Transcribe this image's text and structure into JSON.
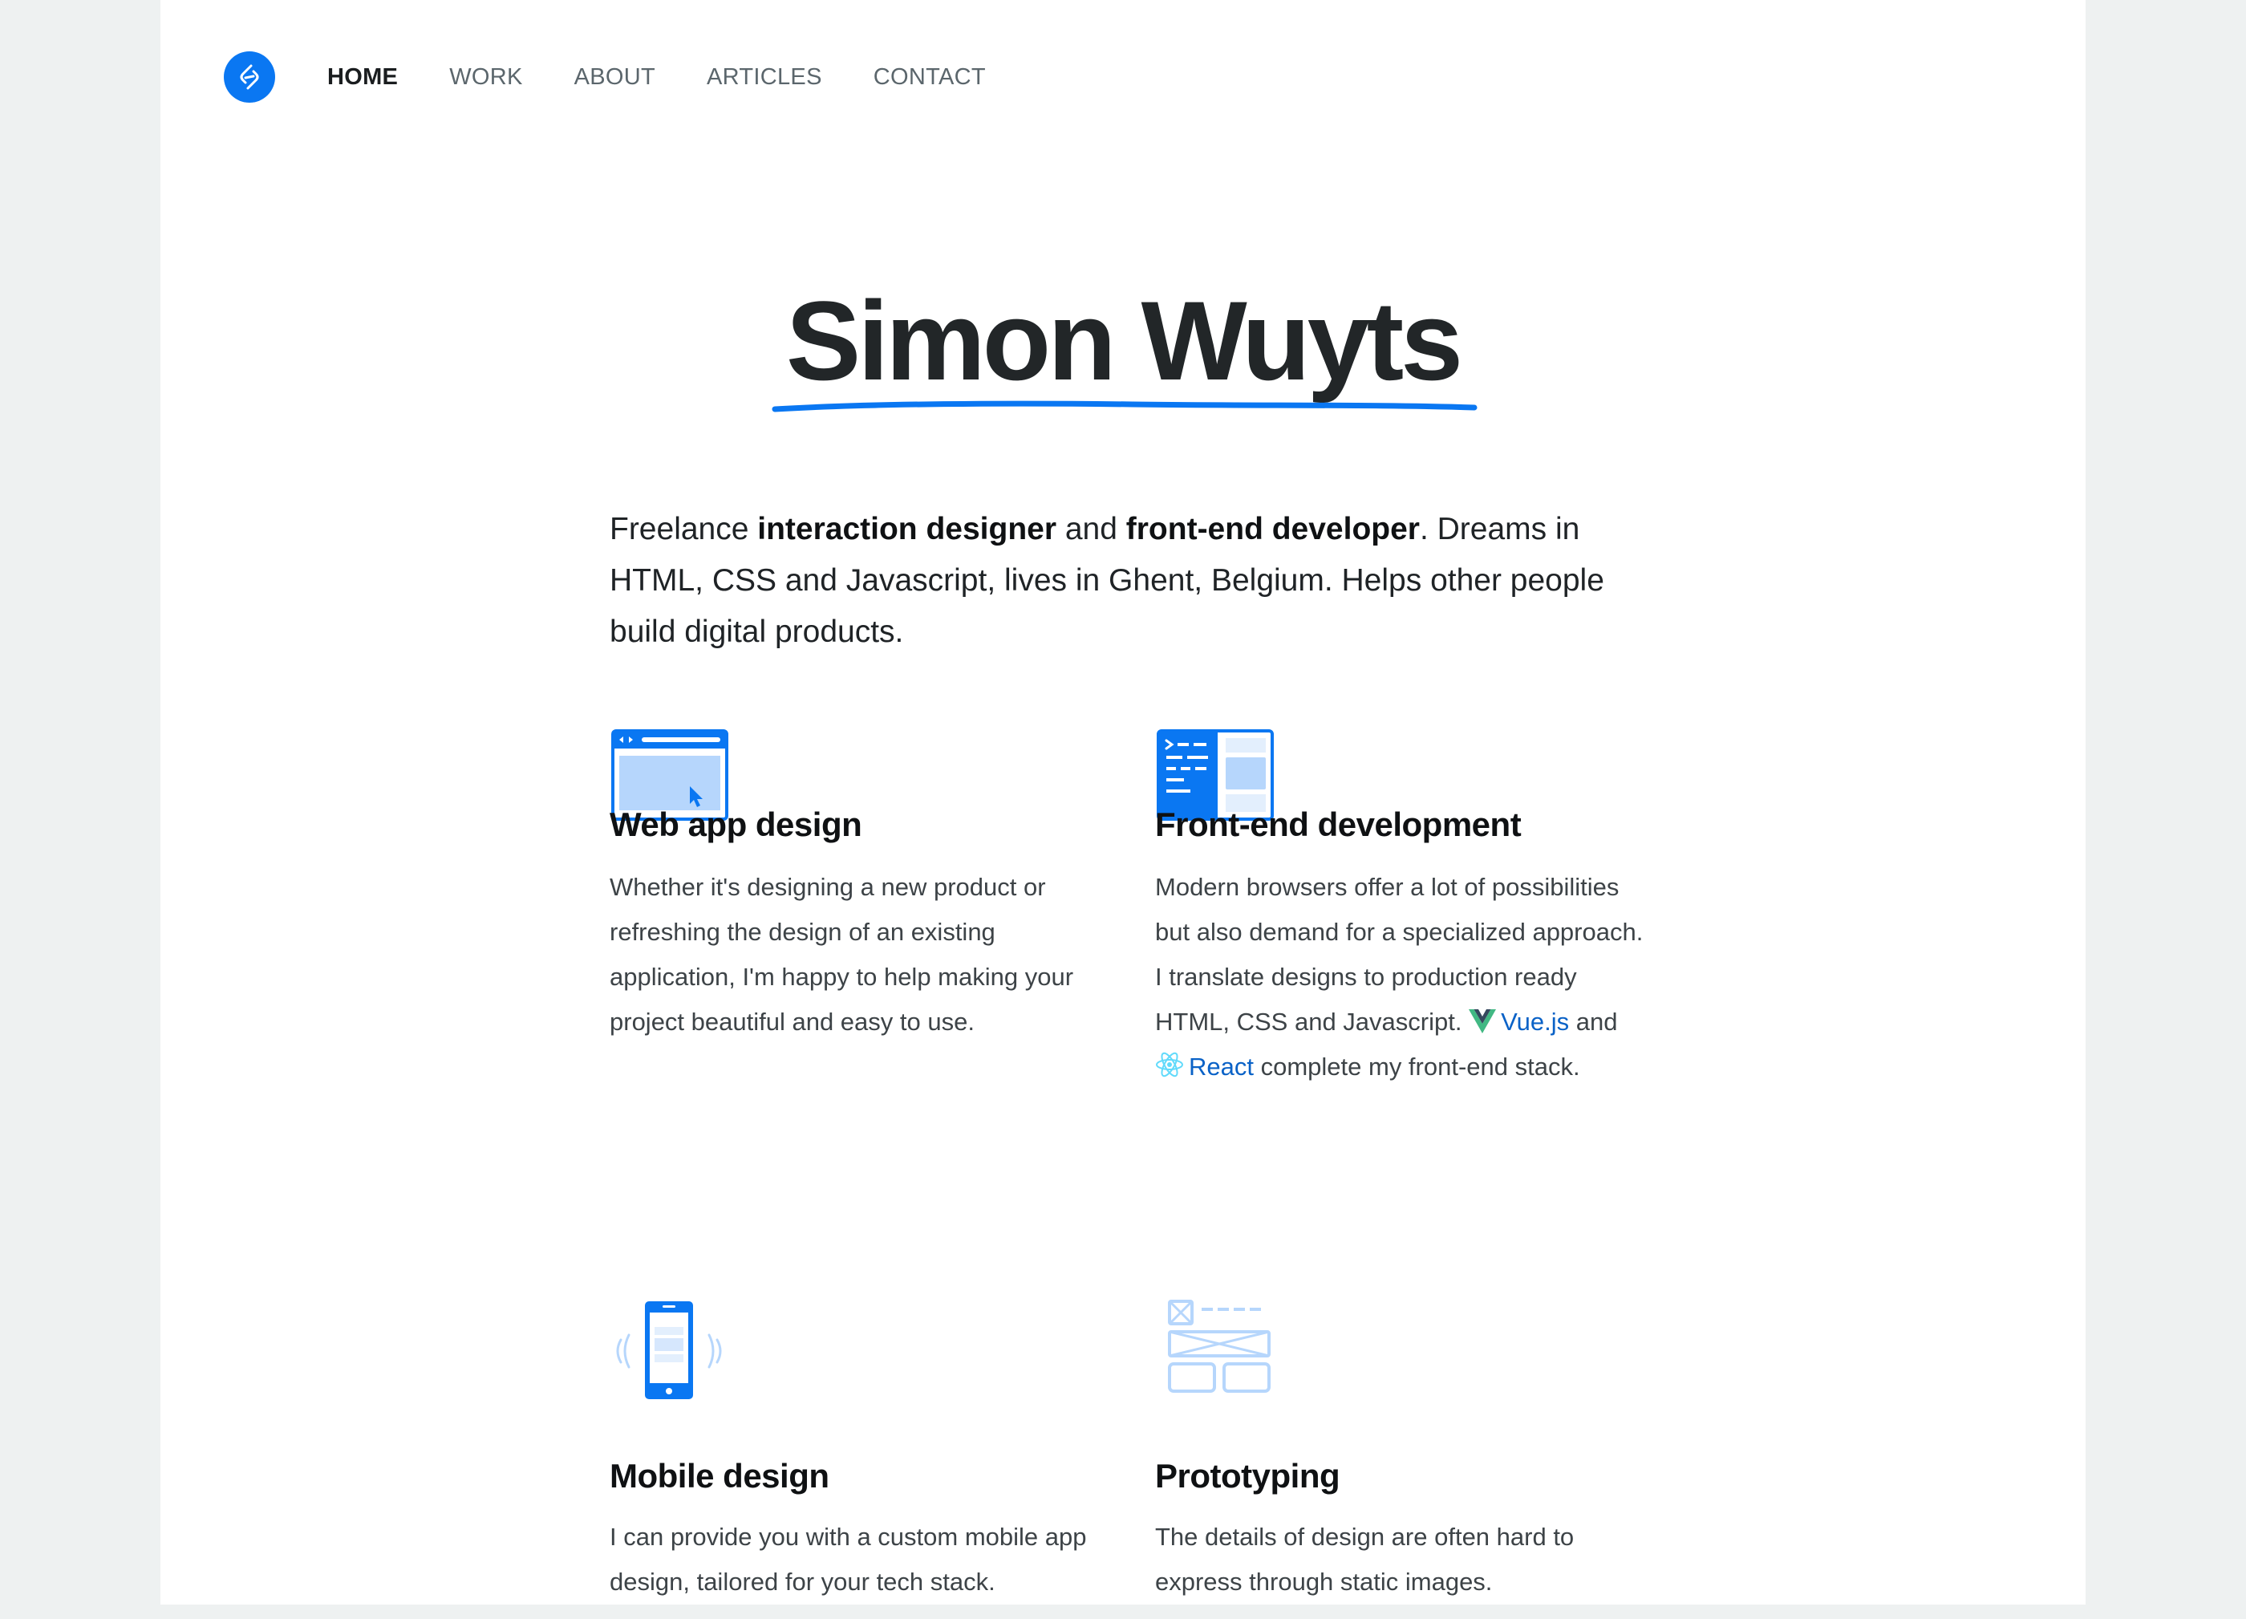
{
  "nav": {
    "items": [
      {
        "label": "HOME",
        "active": true
      },
      {
        "label": "WORK",
        "active": false
      },
      {
        "label": "ABOUT",
        "active": false
      },
      {
        "label": "ARTICLES",
        "active": false
      },
      {
        "label": "CONTACT",
        "active": false
      }
    ]
  },
  "hero": {
    "name": "Simon Wuyts",
    "intro": {
      "t1": "Freelance ",
      "b1": "interaction designer",
      "t2": " and ",
      "b2": "front-end developer",
      "t3": ". Dreams in HTML, CSS and Javascript, lives in Ghent, Belgium. Helps other people build digital products."
    }
  },
  "services": [
    {
      "icon": "browser-window-icon",
      "title": "Web app design",
      "text": "Whether it's designing a new product or refreshing the design of an existing application, I'm happy to help making your project beautiful and easy to use."
    },
    {
      "icon": "code-editor-icon",
      "title": "Front-end development",
      "text_before": "Modern browsers offer a lot of possibilities but also demand for a specialized approach. I translate designs to production ready HTML, CSS and Javascript. ",
      "link1": "Vue.js",
      "text_middle": " and ",
      "link2": "React",
      "text_after": " complete my front-end stack."
    },
    {
      "icon": "mobile-phone-icon",
      "title": "Mobile design",
      "text": "I can provide you with a custom mobile app design, tailored for your tech stack."
    },
    {
      "icon": "wireframe-icon",
      "title": "Prototyping",
      "text": "The details of design are often hard to express through static images."
    }
  ],
  "colors": {
    "accent": "#0a77f2",
    "accent_light": "#b6d6fc",
    "link": "#0a62c7",
    "vue_green": "#41b883",
    "vue_dark": "#35495e",
    "react_blue": "#61dafb",
    "page_bg": "#eef1f1"
  }
}
